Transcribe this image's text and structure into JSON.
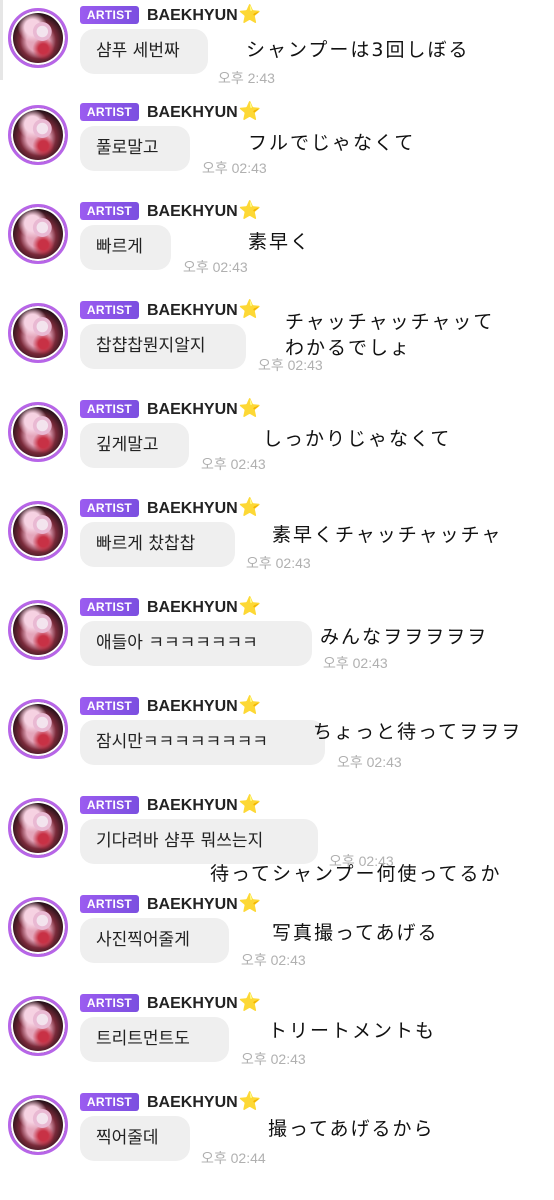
{
  "sender": {
    "badge": "ARTIST",
    "name": "BAEKHYUN",
    "star": "⭐"
  },
  "colors": {
    "badge": "#8e55ea",
    "avatar_ring": "#b765e8",
    "bubble": "#efefef",
    "time": "#b0b0b0"
  },
  "messages": [
    {
      "text": "샴푸 세번짜",
      "time": "오후 2:43",
      "note": "シャンプーは3回しぼる"
    },
    {
      "text": "풀로말고",
      "time": "오후 02:43",
      "note": "フルでじゃなくて"
    },
    {
      "text": "빠르게",
      "time": "오후 02:43",
      "note": "素早く"
    },
    {
      "text": "찹챱찹뭔지알지",
      "time": "오후 02:43",
      "note": "チャッチャッチャッて\nわかるでしょ"
    },
    {
      "text": "깊게말고",
      "time": "오후 02:43",
      "note": "しっかりじゃなくて"
    },
    {
      "text": "빠르게 찼찹찹",
      "time": "오후 02:43",
      "note": "素早くチャッチャッチャ"
    },
    {
      "text": "애들아 ㅋㅋㅋㅋㅋㅋㅋ",
      "time": "오후 02:43",
      "note": "みんなヲヲヲヲヲ"
    },
    {
      "text": "잠시만ㅋㅋㅋㅋㅋㅋㅋㅋ",
      "time": "오후 02:43",
      "note": "ちょっと待ってヲヲヲ"
    },
    {
      "text": "기다려바 샴푸 뭐쓰는지",
      "time": "오후 02:43",
      "note": "待ってシャンプー何使ってるか"
    },
    {
      "text": "사진찍어줄게",
      "time": "오후 02:43",
      "note": "写真撮ってあげる"
    },
    {
      "text": "트리트먼트도",
      "time": "오후 02:43",
      "note": "トリートメントも"
    },
    {
      "text": "찍어줄데",
      "time": "오후 02:44",
      "note": "撮ってあげるから"
    }
  ]
}
